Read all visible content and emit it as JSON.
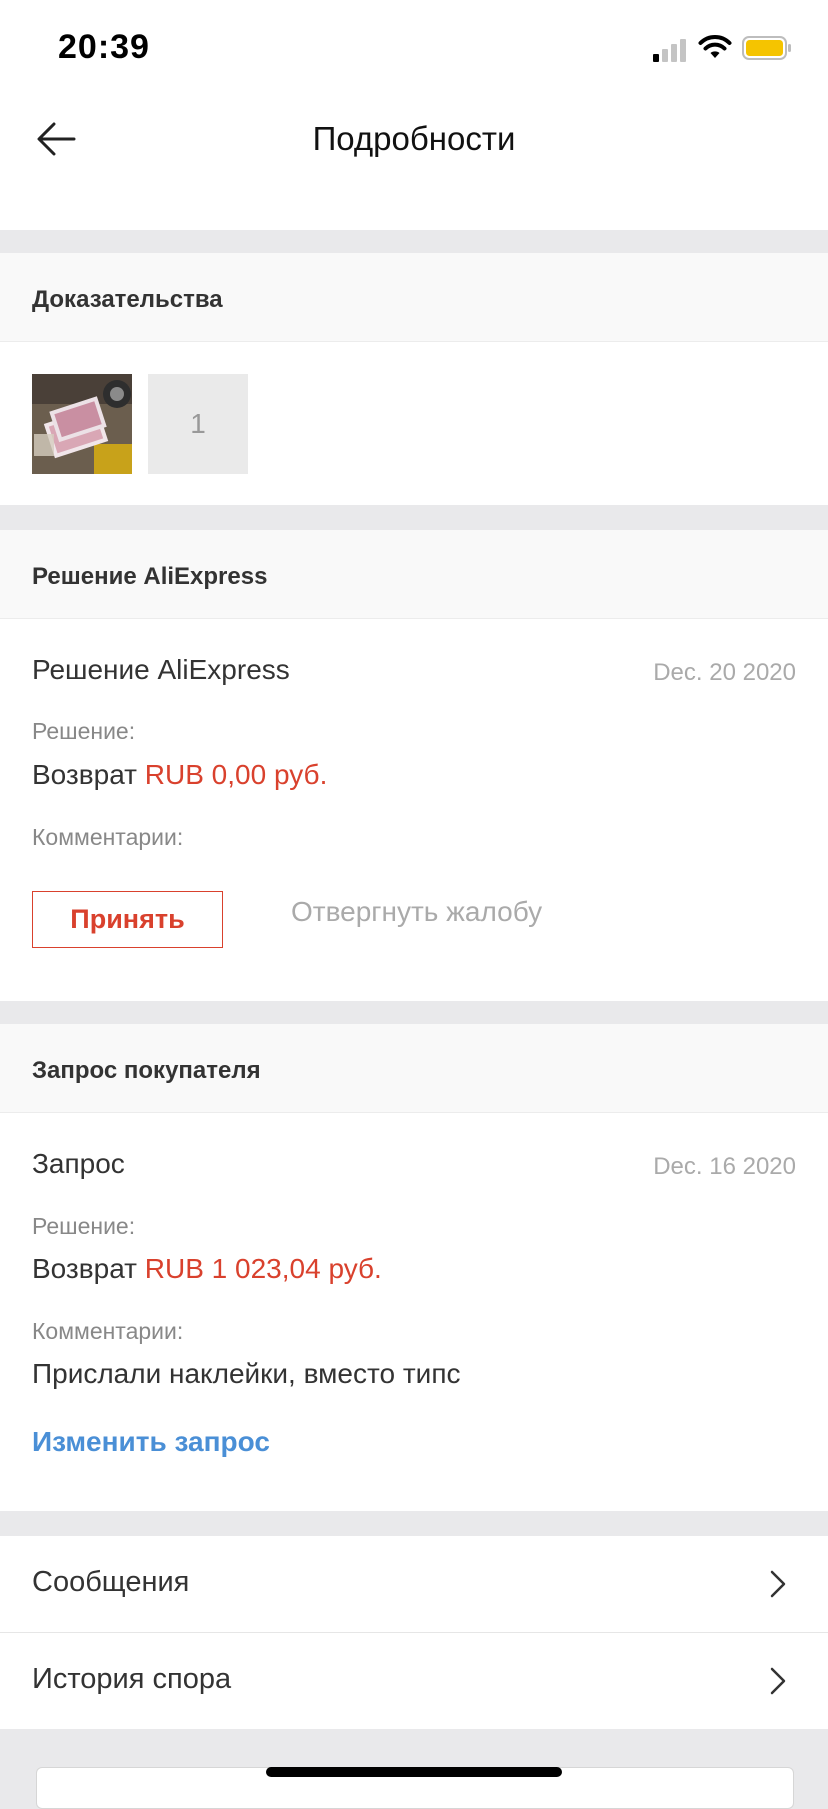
{
  "status_bar": {
    "time": "20:39"
  },
  "header": {
    "title": "Подробности"
  },
  "evidence": {
    "section_title": "Доказательства",
    "image_count": "1"
  },
  "decision": {
    "section_title": "Решение AliExpress",
    "heading": "Решение AliExpress",
    "date": "Dec. 20 2020",
    "solution_label": "Решение:",
    "solution_prefix": "Возврат",
    "solution_amount": "RUB 0,00 руб.",
    "comments_label": "Комментарии:",
    "accept_label": "Принять",
    "reject_label": "Отвергнуть жалобу"
  },
  "request": {
    "section_title": "Запрос покупателя",
    "heading": "Запрос",
    "date": "Dec. 16 2020",
    "solution_label": "Решение:",
    "solution_prefix": "Возврат",
    "solution_amount": "RUB 1 023,04 руб.",
    "comments_label": "Комментарии:",
    "comment_text": "Прислали наклейки, вместо типс",
    "edit_label": "Изменить запрос"
  },
  "menu": [
    {
      "label": "Сообщения"
    },
    {
      "label": "История спора"
    }
  ],
  "colors": {
    "accent_red": "#d9412d",
    "link_blue": "#4a8fd6",
    "battery_yellow": "#f5c400"
  }
}
